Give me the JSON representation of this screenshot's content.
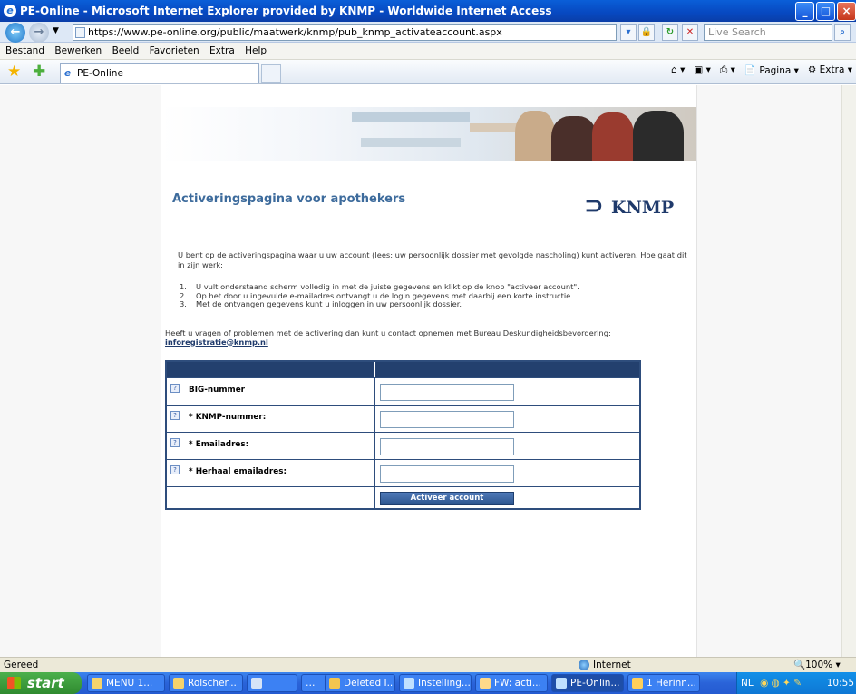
{
  "window": {
    "title": "PE-Online - Microsoft Internet Explorer provided by KNMP - Worldwide Internet Access"
  },
  "address": {
    "url": "https://www.pe-online.org/public/maatwerk/knmp/pub_knmp_activateaccount.aspx",
    "search_placeholder": "Live Search"
  },
  "menu": [
    "Bestand",
    "Bewerken",
    "Beeld",
    "Favorieten",
    "Extra",
    "Help"
  ],
  "tab": {
    "label": "PE-Online"
  },
  "commands": {
    "page": "Pagina",
    "tools": "Extra"
  },
  "page": {
    "heading": "Activeringspagina voor apothekers",
    "logo": "KNMP",
    "intro": "U bent op de activeringspagina waar u uw account (lees: uw persoonlijk dossier met gevolgde nascholing) kunt activeren. Hoe gaat dit in zijn werk:",
    "steps": [
      {
        "num": "1.",
        "text": "U vult onderstaand scherm volledig in met de juiste gegevens en klikt op de knop \"activeer account\"."
      },
      {
        "num": "2.",
        "text": "Op het door u ingevulde e-mailadres ontvangt u de login gegevens met daarbij een korte instructie."
      },
      {
        "num": "3.",
        "text": "Met de ontvangen gegevens kunt u inloggen in uw persoonlijk dossier."
      }
    ],
    "contact_text": "Heeft u vragen of problemen met de activering dan kunt u contact opnemen met Bureau Deskundigheidsbevordering:",
    "contact_email": "inforegistratie@knmp.nl",
    "form": {
      "fields": [
        {
          "label": "BIG-nummer",
          "required": ""
        },
        {
          "label": "KNMP-nummer:",
          "required": "*"
        },
        {
          "label": "Emailadres:",
          "required": "*"
        },
        {
          "label": "Herhaal emailadres:",
          "required": "*"
        }
      ],
      "submit": "Activeer account"
    }
  },
  "status": {
    "text": "Gereed",
    "zone": "Internet",
    "zoom": "100%"
  },
  "taskbar": {
    "start": "start",
    "items": [
      "MENU 1...",
      "Rolscher...",
      "",
      "Deleted I...",
      "Instelling...",
      "FW: acti...",
      "PE-Onlin...",
      "1 Herinn..."
    ],
    "tray": {
      "lang": "NL",
      "time": "10:55"
    }
  }
}
